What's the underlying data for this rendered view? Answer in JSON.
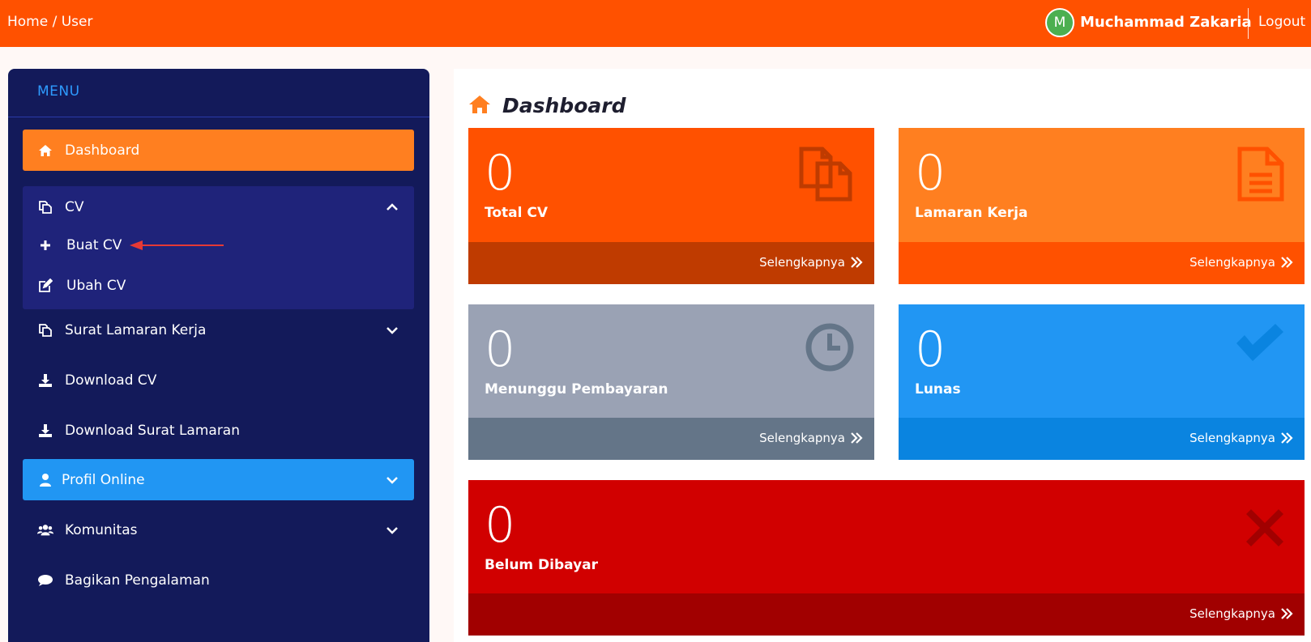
{
  "topbar": {
    "breadcrumb": "Home / User",
    "avatar_initial": "M",
    "user_name": "Muchammad Zakaria",
    "logout_label": "Logout"
  },
  "sidebar": {
    "menu_title": "MENU",
    "items": [
      {
        "label": "Dashboard",
        "icon": "home-icon",
        "state": "active"
      },
      {
        "label": "CV",
        "icon": "copy-icon",
        "state": "expanded"
      },
      {
        "label": "Surat Lamaran Kerja",
        "icon": "copy-icon",
        "state": "collapsed"
      },
      {
        "label": "Download CV",
        "icon": "download-icon"
      },
      {
        "label": "Download Surat Lamaran",
        "icon": "download-icon"
      },
      {
        "label": "Profil Online",
        "icon": "user-icon",
        "state": "highlighted"
      },
      {
        "label": "Komunitas",
        "icon": "users-icon",
        "state": "collapsed"
      },
      {
        "label": "Bagikan Pengalaman",
        "icon": "comment-icon"
      }
    ],
    "cv_subitems": [
      {
        "label": "Buat CV",
        "icon": "plus-icon"
      },
      {
        "label": "Ubah CV",
        "icon": "edit-icon"
      }
    ]
  },
  "main": {
    "title": "Dashboard",
    "cards": [
      {
        "count": "0",
        "label": "Total CV",
        "more": "Selengkapnya",
        "icon": "copy-icon",
        "color": "#ff5100",
        "footer_color": "#bf3b00"
      },
      {
        "count": "0",
        "label": "Lamaran Kerja",
        "more": "Selengkapnya",
        "icon": "file-text-icon",
        "color": "#ff7f20",
        "footer_color": "#ff5100"
      },
      {
        "count": "0",
        "label": "Menunggu Pembayaran",
        "more": "Selengkapnya",
        "icon": "clock-icon",
        "color": "#9aa2b4",
        "footer_color": "#647588"
      },
      {
        "count": "0",
        "label": "Lunas",
        "more": "Selengkapnya",
        "icon": "check-icon",
        "color": "#2196f3",
        "footer_color": "#0a84e0"
      },
      {
        "count": "0",
        "label": "Belum Dibayar",
        "more": "Selengkapnya",
        "icon": "times-icon",
        "color": "#d10000",
        "footer_color": "#a10000"
      }
    ]
  },
  "colors": {
    "topbar": "#ff5100",
    "sidebar": "#131a5a",
    "accent_orange": "#ff7f20",
    "accent_blue": "#2196f3",
    "annotation_red": "#e53935"
  }
}
